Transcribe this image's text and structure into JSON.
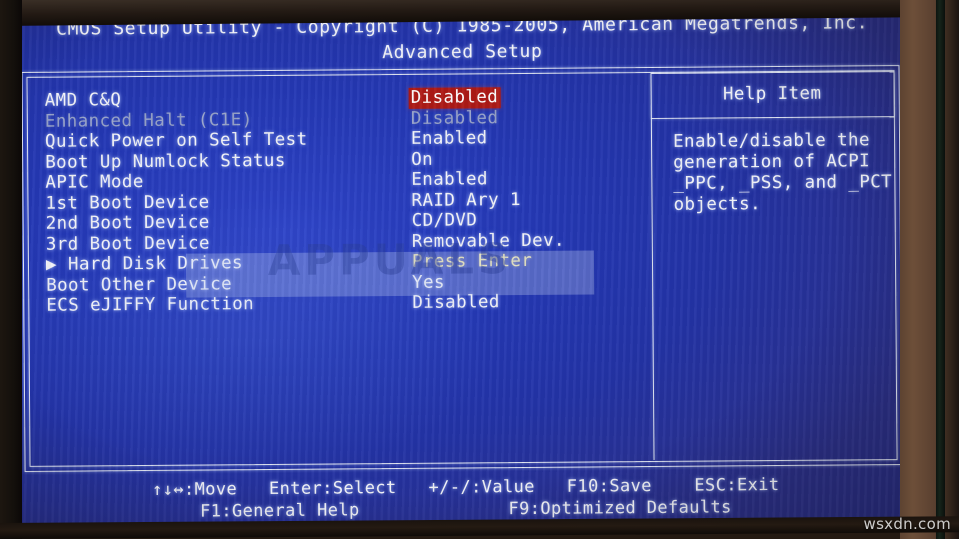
{
  "window": {
    "title_line1": "CMOS Setup Utility - Copyright (C) 1985-2005, American Megatrends, Inc.",
    "title_line2": "Advanced Setup"
  },
  "colors": {
    "screen_blue": "#2438b4",
    "selection_red": "#ad1a16",
    "text_white": "#f2f3f8",
    "text_disabled": "#98a3c9",
    "text_accent": "#ece4ae",
    "frame_white": "#dfe4f2"
  },
  "settings": {
    "rows": [
      {
        "label": "AMD C&Q",
        "value": "Disabled",
        "state": "selected"
      },
      {
        "label": "Enhanced Halt (C1E)",
        "value": "Disabled",
        "state": "disabled"
      },
      {
        "label": "Quick Power on Self Test",
        "value": "Enabled",
        "state": "normal"
      },
      {
        "label": "Boot Up Numlock Status",
        "value": "On",
        "state": "normal"
      },
      {
        "label": "APIC Mode",
        "value": "Enabled",
        "state": "normal"
      },
      {
        "label": "1st Boot Device",
        "value": "RAID Ary 1",
        "state": "normal"
      },
      {
        "label": "2nd Boot Device",
        "value": "CD/DVD",
        "state": "normal"
      },
      {
        "label": "3rd Boot Device",
        "value": "Removable Dev.",
        "state": "normal"
      },
      {
        "label": "Hard Disk Drives",
        "value": "Press Enter",
        "state": "submenu"
      },
      {
        "label": "Boot Other Device",
        "value": "Yes",
        "state": "normal"
      },
      {
        "label": "ECS eJIFFY Function",
        "value": "Disabled",
        "state": "normal"
      }
    ],
    "submenu_arrow": "▶"
  },
  "help": {
    "title": "Help Item",
    "body": "Enable/disable the\ngeneration of ACPI\n_PPC, _PSS, and _PCT\nobjects."
  },
  "legend": {
    "line1": "↑↓↔:Move   Enter:Select   +/-/:Value   F10:Save    ESC:Exit",
    "line2": "F1:General Help              F9:Optimized Defaults"
  },
  "watermarks": {
    "center": "APPUALS",
    "corner": "wsxdn.com"
  }
}
